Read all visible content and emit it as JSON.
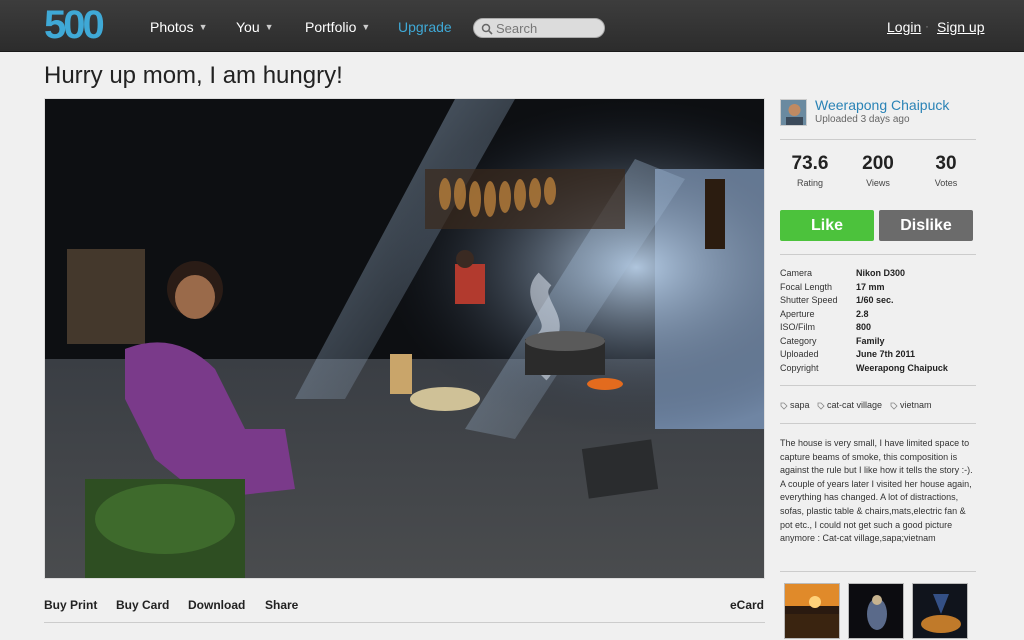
{
  "nav": {
    "logo": "500",
    "items": [
      {
        "label": "Photos"
      },
      {
        "label": "You"
      },
      {
        "label": "Portfolio"
      },
      {
        "label": "Upgrade"
      }
    ],
    "search_placeholder": "Search",
    "login": "Login",
    "separator": "·",
    "signup": "Sign up"
  },
  "photo": {
    "title": "Hurry up mom, I am hungry!"
  },
  "actions": {
    "buy_print": "Buy Print",
    "buy_card": "Buy Card",
    "download": "Download",
    "share": "Share",
    "ecard": "eCard"
  },
  "author": {
    "name": "Weerapong Chaipuck",
    "uploaded": "Uploaded 3 days ago"
  },
  "stats": [
    {
      "value": "73.6",
      "label": "Rating"
    },
    {
      "value": "200",
      "label": "Views"
    },
    {
      "value": "30",
      "label": "Votes"
    }
  ],
  "vote": {
    "like": "Like",
    "dislike": "Dislike",
    "like_color": "#4cc23c",
    "dislike_color": "#6b6b6b"
  },
  "meta": [
    {
      "key": "Camera",
      "value": "Nikon D300"
    },
    {
      "key": "Focal Length",
      "value": "17 mm"
    },
    {
      "key": "Shutter Speed",
      "value": "1/60 sec."
    },
    {
      "key": "Aperture",
      "value": "2.8"
    },
    {
      "key": "ISO/Film",
      "value": "800"
    },
    {
      "key": "Category",
      "value": "Family"
    },
    {
      "key": "Uploaded",
      "value": "June 7th 2011"
    },
    {
      "key": "Copyright",
      "value": "Weerapong Chaipuck"
    }
  ],
  "tags": [
    "sapa",
    "cat-cat village",
    "vietnam"
  ],
  "description": "The house is very small, I have limited space to capture beams of smoke, this composition is against the rule but I like how it tells the story :-). A couple of years later I visited her house again, everything has changed. A lot of distractions, sofas, plastic table & chairs,mats,electric fan & pot etc., I could not get such a good picture anymore : Cat-cat village,sapa;vietnam",
  "colors": {
    "accent": "#3fa9d6",
    "link": "#2a83b6",
    "topbar": "#333333"
  }
}
